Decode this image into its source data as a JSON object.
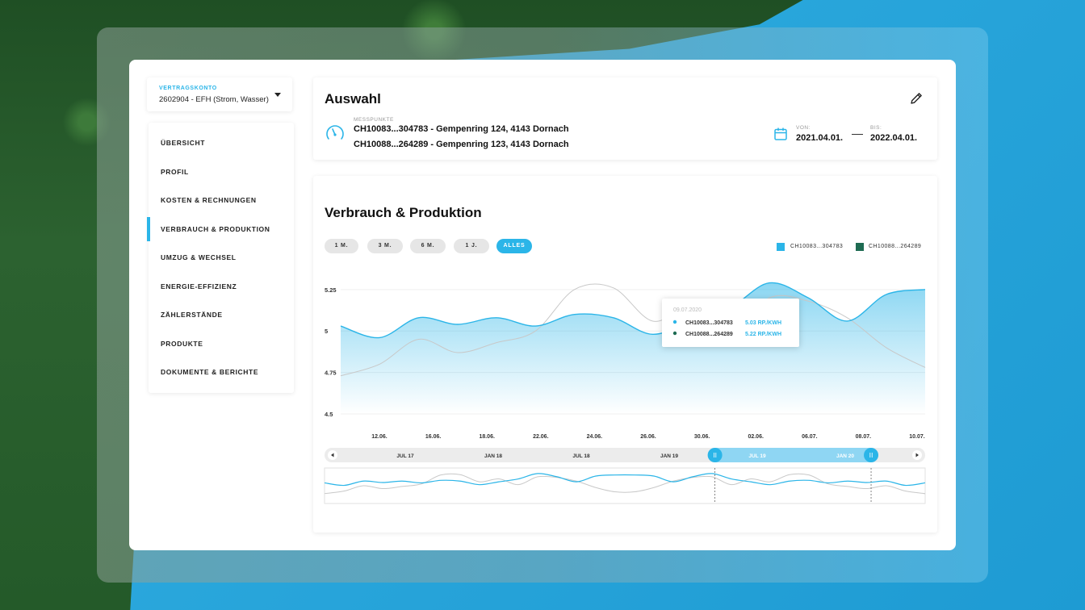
{
  "account": {
    "label": "VERTRAGSKONTO",
    "value": "2602904 - EFH (Strom, Wasser)"
  },
  "nav": {
    "items": [
      {
        "label": "ÜBERSICHT",
        "active": false
      },
      {
        "label": "PROFIL",
        "active": false
      },
      {
        "label": "KOSTEN & RECHNUNGEN",
        "active": false
      },
      {
        "label": "VERBRAUCH & PRODUKTION",
        "active": true
      },
      {
        "label": "UMZUG & WECHSEL",
        "active": false
      },
      {
        "label": "ENERGIE-EFFIZIENZ",
        "active": false
      },
      {
        "label": "ZÄHLERSTÄNDE",
        "active": false
      },
      {
        "label": "PRODUKTE",
        "active": false
      },
      {
        "label": "DOKUMENTE & BERICHTE",
        "active": false
      }
    ]
  },
  "selection": {
    "title": "Auswahl",
    "meters_label": "MESSPUNKTE",
    "meters": [
      "CH10083...304783 - Gempenring 124, 4143 Dornach",
      "CH10088...264289 - Gempenring 123, 4143 Dornach"
    ],
    "from_label": "VON:",
    "from_value": "2021.04.01.",
    "to_label": "BIS:",
    "to_value": "2022.04.01."
  },
  "consumption": {
    "title": "Verbrauch & Produktion",
    "ranges": [
      "1 M.",
      "3 M.",
      "6 M.",
      "1 J.",
      "ALLES"
    ],
    "active_range": "ALLES",
    "tooltip": {
      "date": "09.07.2020",
      "rows": [
        {
          "name": "CH10083...304783",
          "value": "5.03 RP./KWH"
        },
        {
          "name": "CH10088...264289",
          "value": "5.22 RP./KWH"
        }
      ]
    },
    "navigator": {
      "labels": [
        "JUL 17",
        "JAN 18",
        "JUL 18",
        "JAN 19",
        "JUL 19",
        "JAN 20"
      ],
      "selection_start": 0.65,
      "selection_end": 0.91
    }
  },
  "colors": {
    "accent": "#2bb5e8",
    "series2": "#1e6b52",
    "grey_line": "#c8c8c8"
  },
  "chart_data": {
    "type": "area",
    "x": [
      "10.06.",
      "12.06.",
      "14.06.",
      "16.06.",
      "18.06.",
      "20.06.",
      "22.06.",
      "24.06.",
      "26.06.",
      "28.06.",
      "30.06.",
      "02.06.",
      "04.06.",
      "06.07.",
      "08.07.",
      "10.07."
    ],
    "x_tick_labels": [
      "12.06.",
      "16.06.",
      "18.06.",
      "22.06.",
      "24.06.",
      "26.06.",
      "30.06.",
      "02.06.",
      "06.07.",
      "08.07.",
      "10.07."
    ],
    "y_ticks": [
      4.5,
      4.75,
      5,
      5.25
    ],
    "ylim": [
      4.5,
      5.4
    ],
    "legend_position": "top-right",
    "series": [
      {
        "name": "CH10083...304783",
        "color": "#2bb5e8",
        "values": [
          5.03,
          4.96,
          5.08,
          5.04,
          5.08,
          5.03,
          5.1,
          5.08,
          4.98,
          5.06,
          5.14,
          5.29,
          5.2,
          5.06,
          5.22,
          5.25
        ]
      },
      {
        "name": "CH10088...264289",
        "color": "#1e6b52",
        "values": [
          4.73,
          4.8,
          4.95,
          4.87,
          4.93,
          5.0,
          5.25,
          5.26,
          5.06,
          5.14,
          4.98,
          5.2,
          5.18,
          5.08,
          4.9,
          4.78
        ]
      }
    ]
  }
}
